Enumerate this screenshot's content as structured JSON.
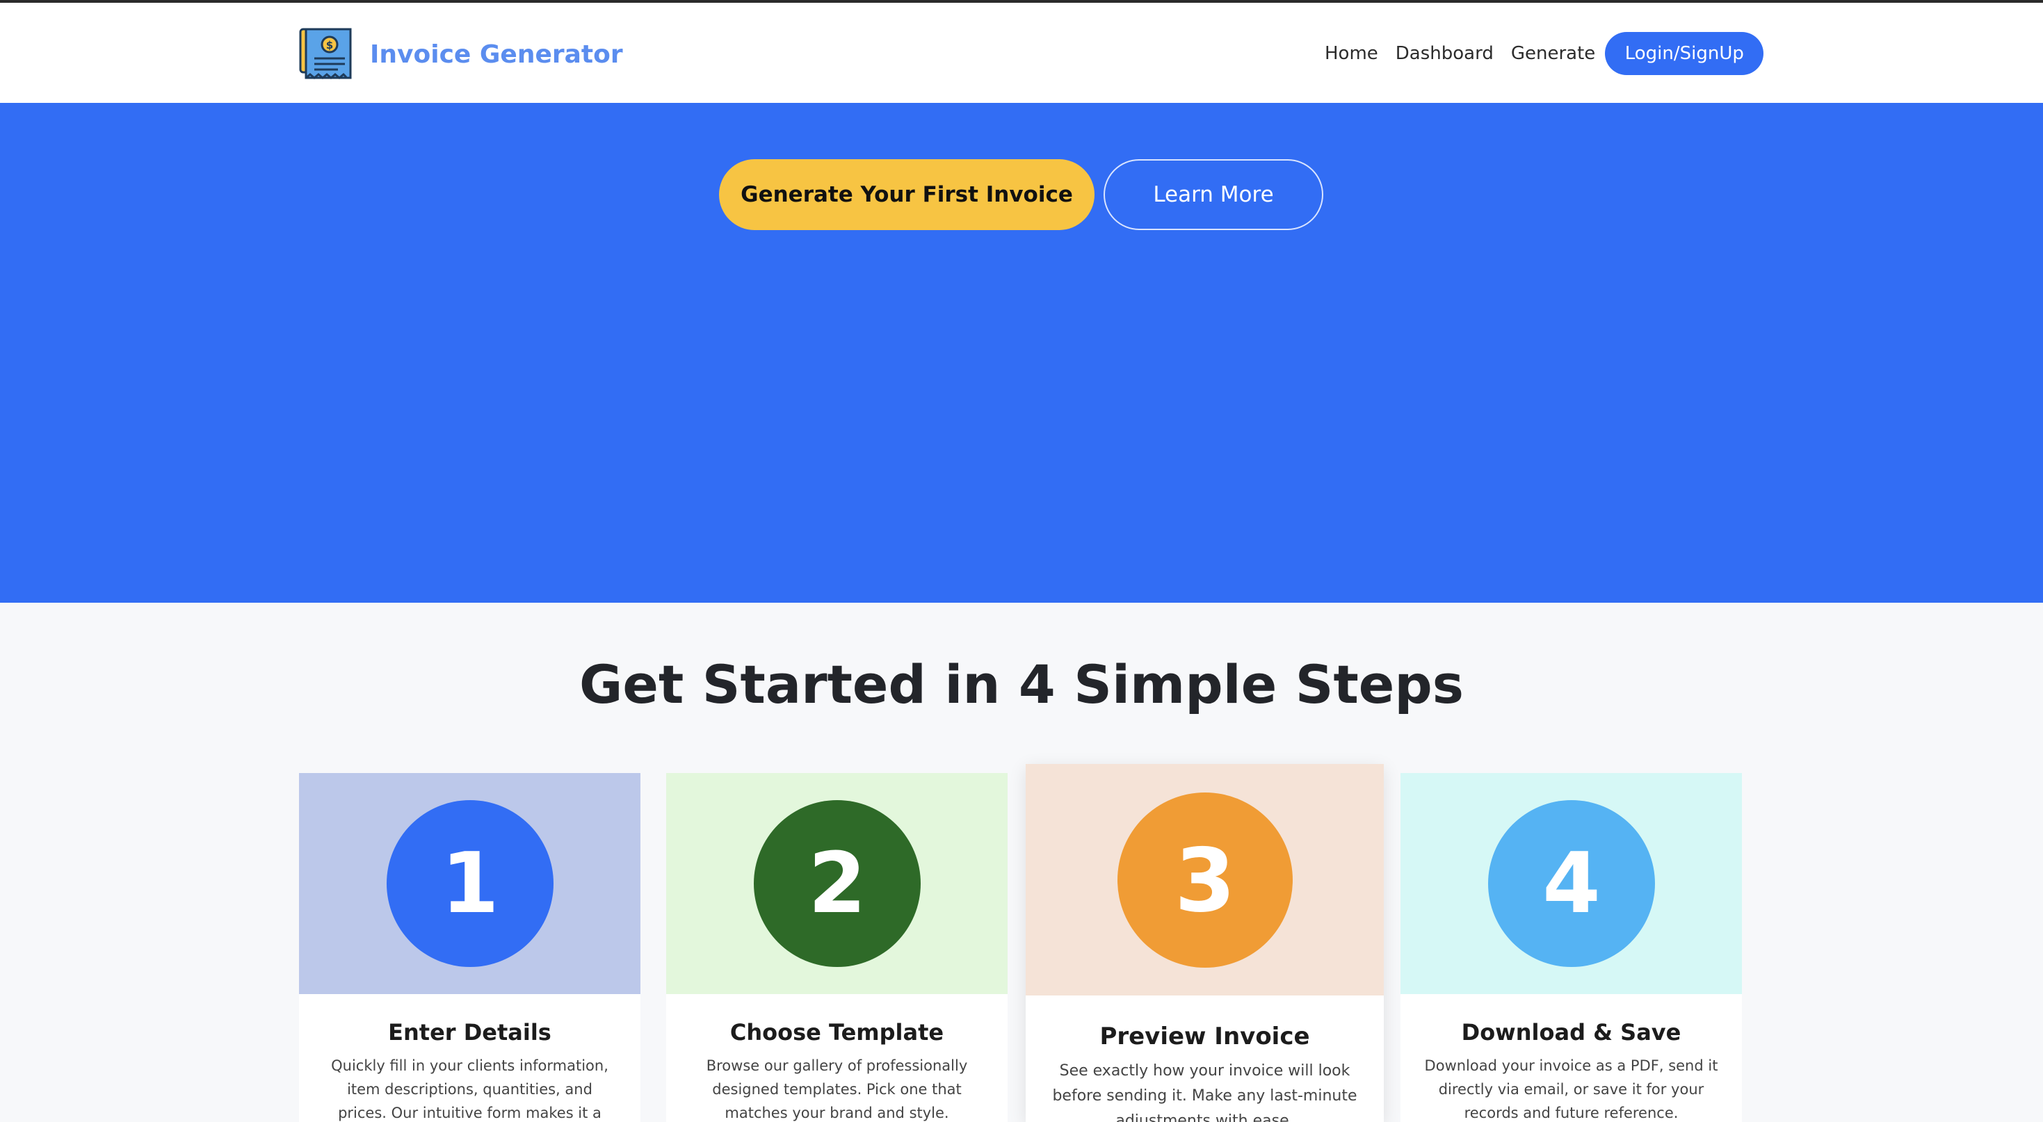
{
  "brand": {
    "name": "Invoice Generator"
  },
  "nav": {
    "items": [
      {
        "label": "Home"
      },
      {
        "label": "Dashboard"
      },
      {
        "label": "Generate"
      }
    ],
    "login_label": "Login/SignUp"
  },
  "hero": {
    "primary_cta": "Generate Your First Invoice",
    "secondary_cta": "Learn More"
  },
  "steps": {
    "title": "Get Started in 4 Simple Steps",
    "items": [
      {
        "number": "1",
        "title": "Enter Details",
        "description": "Quickly fill in your clients information, item descriptions, quantities, and prices. Our intuitive form makes it a breeze."
      },
      {
        "number": "2",
        "title": "Choose Template",
        "description": "Browse our gallery of professionally designed templates. Pick one that matches your brand and style."
      },
      {
        "number": "3",
        "title": "Preview Invoice",
        "description": "See exactly how your invoice will look before sending it. Make any last-minute adjustments with ease."
      },
      {
        "number": "4",
        "title": "Download & Save",
        "description": "Download your invoice as a PDF, send it directly via email, or save it for your records and future reference."
      }
    ]
  },
  "colors": {
    "primary_blue": "#326df4",
    "accent_yellow": "#f7c443",
    "brand_text": "#5b8def",
    "step1_bg": "#bcc8ea",
    "step1_circle": "#326df4",
    "step2_bg": "#e3f7dc",
    "step2_circle": "#2e6a28",
    "step3_bg": "#f5e3d7",
    "step3_circle": "#f09c35",
    "step4_bg": "#d6f8f6",
    "step4_circle": "#55b3f3"
  }
}
